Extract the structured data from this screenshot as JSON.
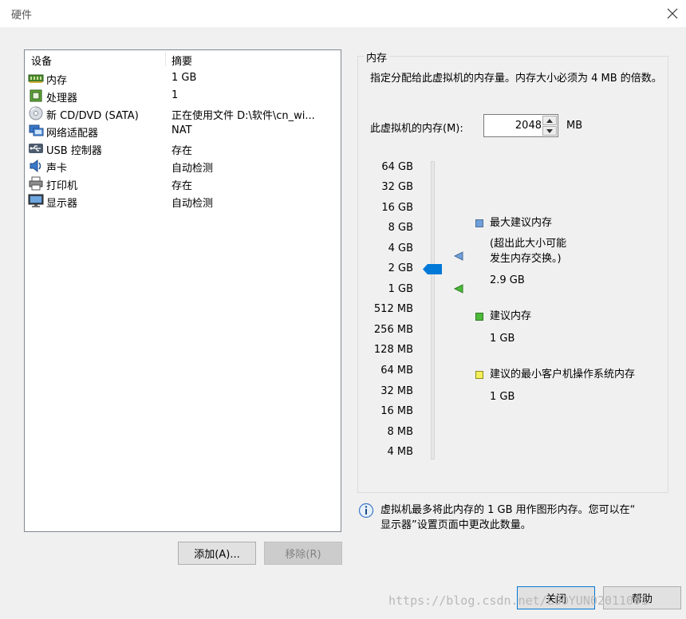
{
  "window": {
    "title": "硬件"
  },
  "devices": {
    "col_device": "设备",
    "col_summary": "摘要",
    "rows": [
      {
        "name": "内存",
        "summary": "1 GB",
        "icon": "memory-icon"
      },
      {
        "name": "处理器",
        "summary": "1",
        "icon": "processor-icon"
      },
      {
        "name": "新 CD/DVD (SATA)",
        "summary": "正在使用文件 D:\\软件\\cn_wi...",
        "icon": "cd-dvd-icon"
      },
      {
        "name": "网络适配器",
        "summary": "NAT",
        "icon": "network-adapter-icon"
      },
      {
        "name": "USB 控制器",
        "summary": "存在",
        "icon": "usb-icon"
      },
      {
        "name": "声卡",
        "summary": "自动检测",
        "icon": "sound-card-icon"
      },
      {
        "name": "打印机",
        "summary": "存在",
        "icon": "printer-icon"
      },
      {
        "name": "显示器",
        "summary": "自动检测",
        "icon": "display-icon"
      }
    ],
    "add_label": "添加(A)...",
    "remove_label": "移除(R)"
  },
  "memory": {
    "group_title": "内存",
    "description": "指定分配给此虚拟机的内存量。内存大小必须为 4 MB 的倍数。",
    "field_label": "此虚拟机的内存(M):",
    "value": "2048",
    "unit": "MB",
    "scale": [
      "64 GB",
      "32 GB",
      "16 GB",
      "8 GB",
      "4 GB",
      "2 GB",
      "1 GB",
      "512 MB",
      "256 MB",
      "128 MB",
      "64 MB",
      "32 MB",
      "16 MB",
      "8 MB",
      "4 MB"
    ],
    "legend": {
      "max_title": "最大建议内存",
      "max_note_line1": "(超出此大小可能",
      "max_note_line2": "发生内存交换。)",
      "max_value": "2.9 GB",
      "rec_title": "建议内存",
      "rec_value": "1 GB",
      "min_title": "建议的最小客户机操作系统内存",
      "min_value": "1 GB"
    },
    "info_line1": "虚拟机最多将此内存的 1 GB 用作图形内存。您可以在“",
    "info_line2": "显示器”设置页面中更改此数量。"
  },
  "footer": {
    "close_label": "关闭",
    "help_label": "帮助"
  },
  "watermark": "https://blog.csdn.net/LUOYUN02011001",
  "colors": {
    "thumb": "#0078d7",
    "max_marker": "#6f9fd8",
    "rec_marker": "#4cba3a",
    "min_marker": "#f5f05a"
  }
}
